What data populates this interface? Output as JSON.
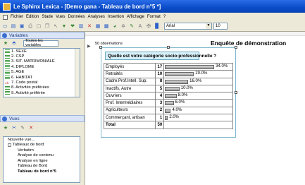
{
  "window": {
    "title": "Le Sphinx Lexica - [Demo gana - Tableau de bord n°5 *]"
  },
  "menu": [
    "Fichier",
    "Edition",
    "Stade",
    "Vues",
    "Données",
    "Analyses",
    "Insertion",
    "Affichage",
    "Format",
    "?"
  ],
  "toolbar": {
    "icons": [
      "new-icon",
      "open-icon",
      "save-icon",
      "print-icon",
      "preview-icon",
      "copy-icon",
      "cursor-icon",
      "filter-icon",
      "heart-icon",
      "chart-icon",
      "delete-icon",
      "table-icon",
      "grid-icon",
      "pie-icon",
      "gear-icon",
      "brush-icon",
      "text-icon",
      "zoom-icon",
      "color-icon"
    ],
    "font": "Arial",
    "font_size": "10"
  },
  "variables_panel": {
    "header": "Variables",
    "filter": "Toutes les variables",
    "items": [
      {
        "label": "1. SEXE",
        "type": "closed"
      },
      {
        "label": "2. CSP",
        "type": "closed"
      },
      {
        "label": "3. SIT. MATRIMONIALE",
        "type": "closed"
      },
      {
        "label": "4. DIPLOME",
        "type": "closed"
      },
      {
        "label": "5. AGE",
        "type": "numeric"
      },
      {
        "label": "6. HABITAT",
        "type": "closed"
      },
      {
        "label": "7. Code postal",
        "type": "text"
      },
      {
        "label": "8. Activités préférées",
        "type": "closed"
      },
      {
        "label": "9. Activité préférée",
        "type": "closed"
      }
    ]
  },
  "vues_panel": {
    "header": "Vues",
    "tree": [
      {
        "label": "Nouvelle vue...",
        "level": 0
      },
      {
        "label": "Tableaux de bord",
        "level": 1,
        "expanded": true
      },
      {
        "label": "Verbatim",
        "level": 2
      },
      {
        "label": "Analyse de contenu",
        "level": 2
      },
      {
        "label": "Analyse en ligne",
        "level": 2
      },
      {
        "label": "Tableau de Bord",
        "level": 2
      },
      {
        "label": "Tableau de bord n°5",
        "level": 2,
        "selected": true
      }
    ]
  },
  "report": {
    "observations": "50 observations",
    "survey_title": "Enquête de démonstration",
    "question": "Quelle est votre catégorie socio-professionnelle ?",
    "rows": [
      {
        "label": "Employés",
        "count": "17",
        "pct": 34.0,
        "pct_label": "34.0%"
      },
      {
        "label": "Retraités",
        "count": "10",
        "pct": 20.0,
        "pct_label": "20.0%"
      },
      {
        "label": "Cadre.Prof.Intell. Sup.",
        "count": "8",
        "pct": 16.0,
        "pct_label": "16.0%"
      },
      {
        "label": "Inactifs, Autre",
        "count": "5",
        "pct": 10.0,
        "pct_label": "10.0%"
      },
      {
        "label": "Ouvriers",
        "count": "4",
        "pct": 8.0,
        "pct_label": "8.0%"
      },
      {
        "label": "Prof. Intermédiaires",
        "count": "3",
        "pct": 6.0,
        "pct_label": "6.0%"
      },
      {
        "label": "Agriculteurs",
        "count": "2",
        "pct": 4.0,
        "pct_label": "4.0%"
      },
      {
        "label": "Commerçant, artisan",
        "count": "1",
        "pct": 2.0,
        "pct_label": "2.0%"
      }
    ],
    "total_label": "Total",
    "total_count": "50"
  }
}
